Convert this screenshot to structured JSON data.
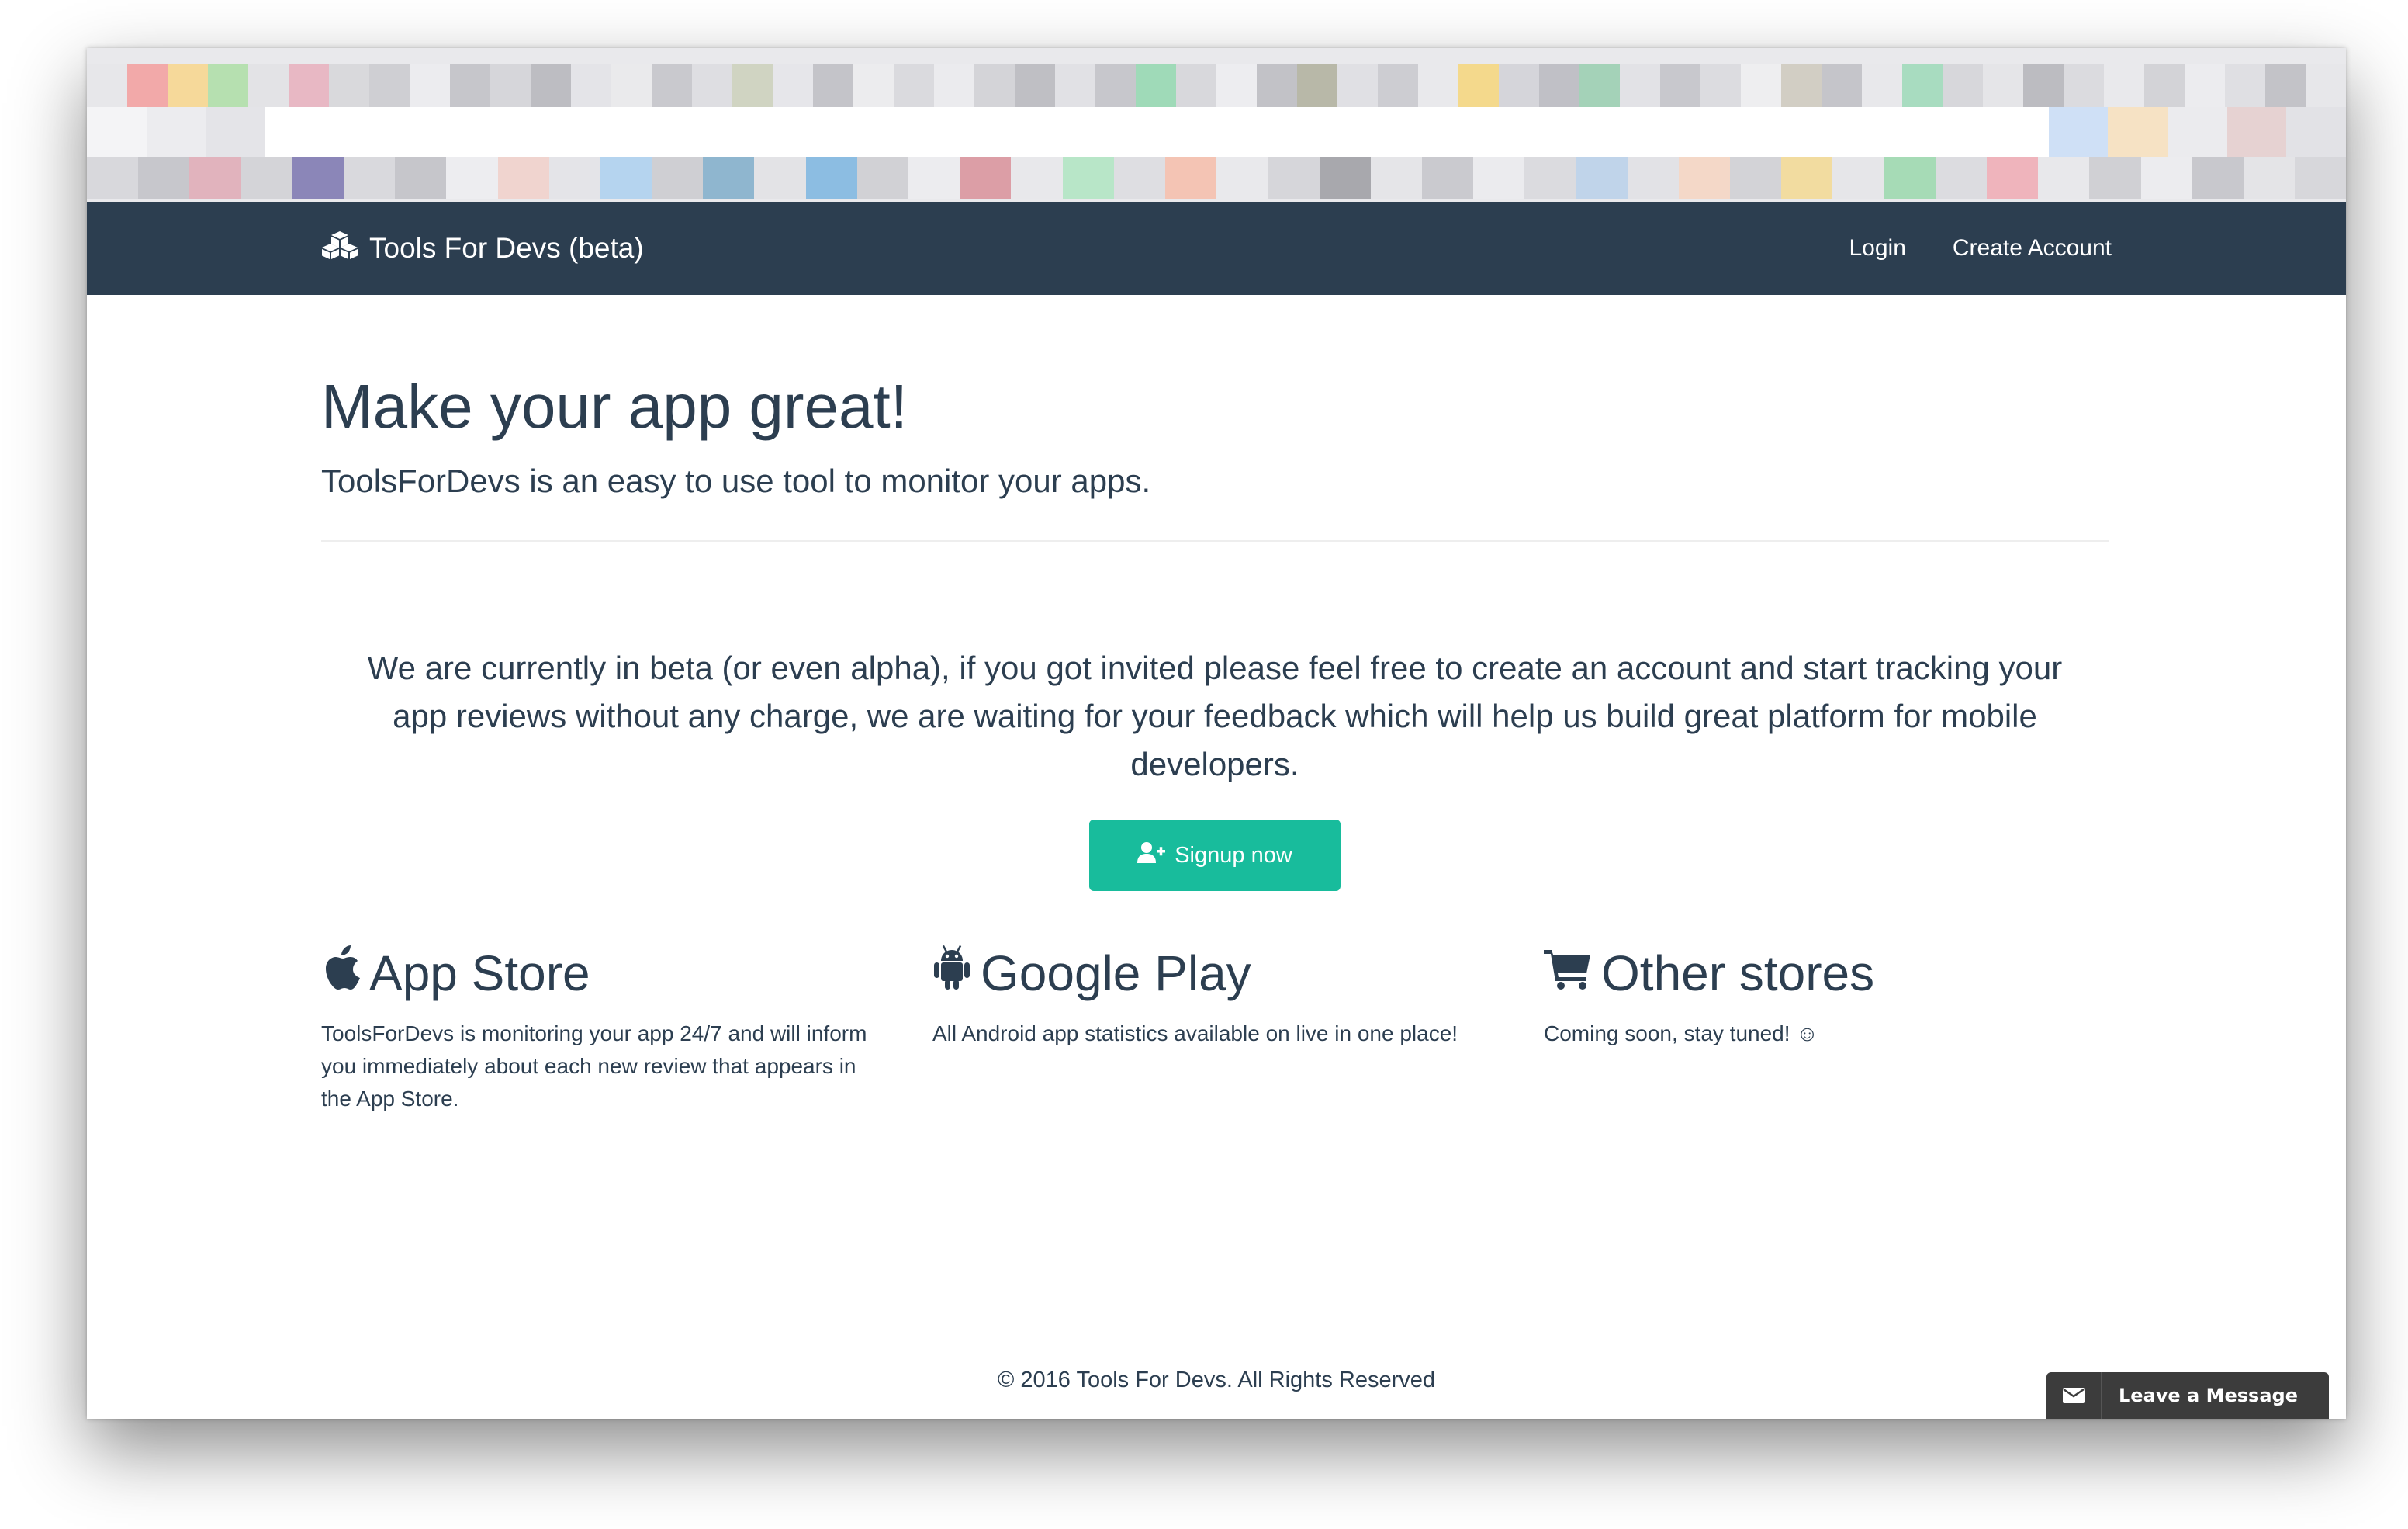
{
  "navbar": {
    "brand": "Tools For Devs (beta)",
    "brand_icon": "cubes-icon",
    "links": [
      "Login",
      "Create Account"
    ]
  },
  "hero": {
    "title": "Make your app great!",
    "subtitle": "ToolsForDevs is an easy to use tool to monitor your apps."
  },
  "beta_notice": "We are currently in beta (or even alpha), if you got invited please feel free to create an account and start tracking your app reviews without any charge, we are waiting for your feedback which will help us build great platform for mobile developers.",
  "signup": {
    "label": "Signup now",
    "icon": "user-plus-icon"
  },
  "features": [
    {
      "icon": "apple-icon",
      "title": "App Store",
      "text": "ToolsForDevs is monitoring your app 24/7 and will inform you immediately about each new review that appears in the App Store."
    },
    {
      "icon": "android-icon",
      "title": "Google Play",
      "text": "All Android app statistics available on live in one place!"
    },
    {
      "icon": "cart-icon",
      "title": "Other stores",
      "text": "Coming soon, stay tuned! ☺"
    }
  ],
  "footer": "© 2016 Tools For Devs. All Rights Reserved",
  "chat_widget": {
    "label": "Leave a Message",
    "icon": "envelope-icon"
  },
  "colors": {
    "navbar": "#2c3e50",
    "accent": "#18bc9c",
    "text": "#2c3e50"
  }
}
